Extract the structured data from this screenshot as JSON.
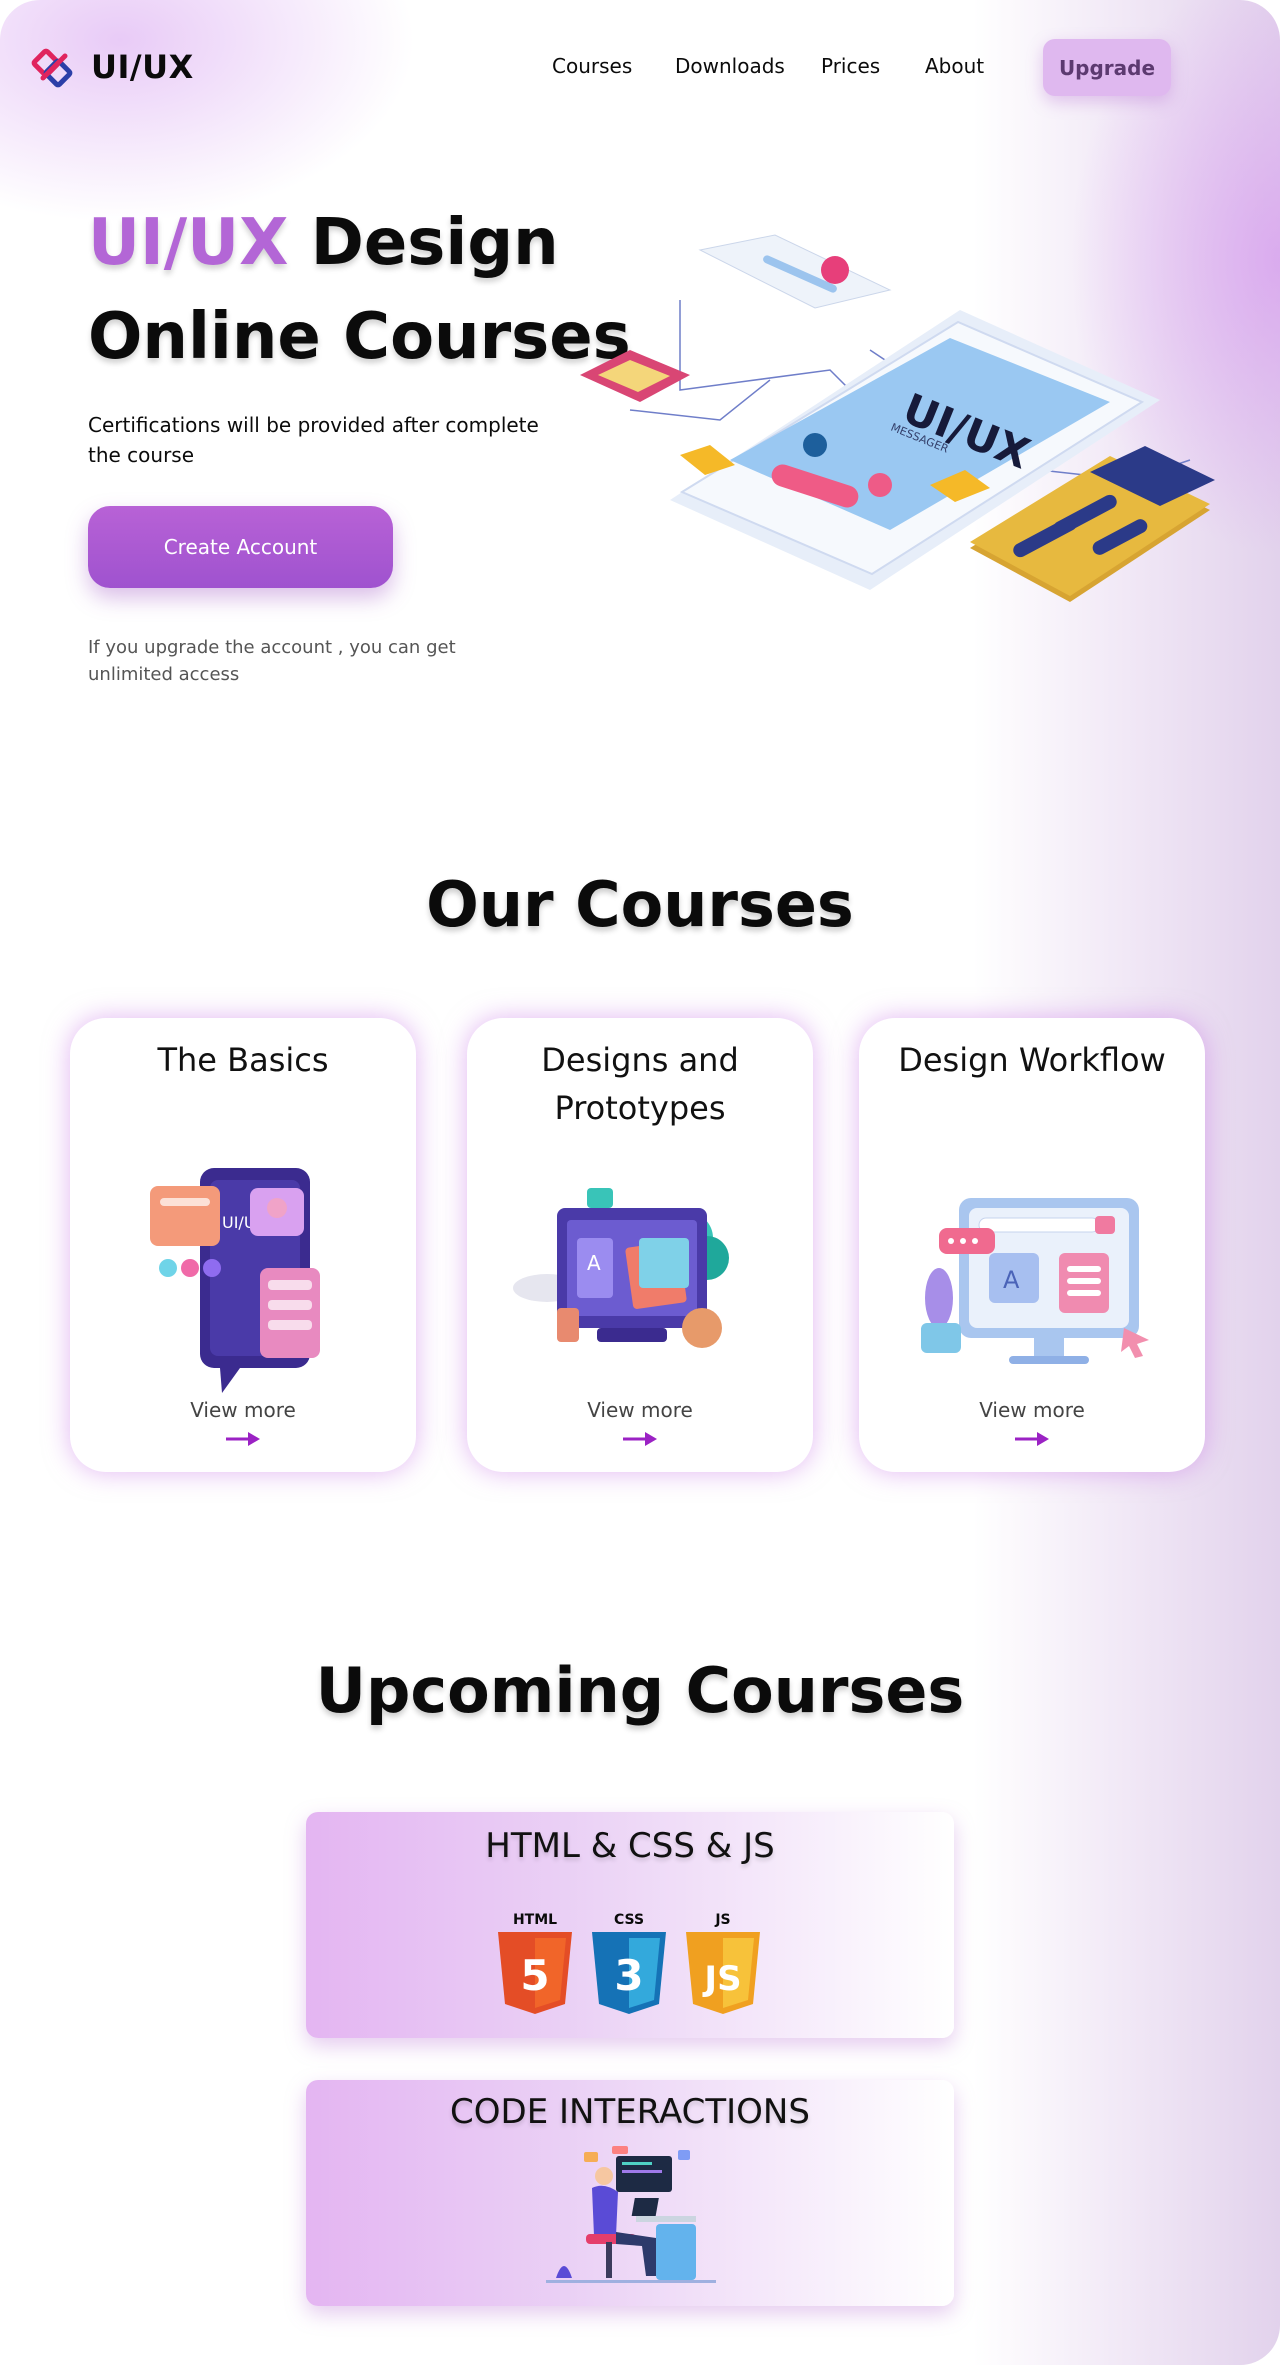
{
  "brand": {
    "name": "UI/UX"
  },
  "nav": {
    "items": [
      "Courses",
      "Downloads",
      "Prices",
      "About"
    ],
    "upgrade": "Upgrade"
  },
  "hero": {
    "title_accent": "UI/UX",
    "title_rest": " Design",
    "title_line2": "Online Courses",
    "subtitle": "Certifications will be provided after  complete the course",
    "cta": "Create Account",
    "note": "If you upgrade the account , you can get unlimited access",
    "illustration_text": "UI/UX",
    "illustration_subtext": "MESSAGER"
  },
  "courses": {
    "title": "Our Courses",
    "cards": [
      {
        "title": "The Basics",
        "link": "View more",
        "illustration_text": "UI/UX"
      },
      {
        "title": "Designs and Prototypes",
        "link": "View more"
      },
      {
        "title": "Design Workflow",
        "link": "View more"
      }
    ]
  },
  "upcoming": {
    "title": "Upcoming Courses",
    "items": [
      {
        "title": "HTML & CSS & JS",
        "badges": [
          "HTML",
          "CSS",
          "JS"
        ]
      },
      {
        "title": "CODE INTERACTIONS"
      }
    ]
  },
  "colors": {
    "accent": "#b366d6",
    "button": "#a85ad2",
    "upgrade_bg": "#dfb8ef",
    "arrow": "#9b22c4"
  }
}
